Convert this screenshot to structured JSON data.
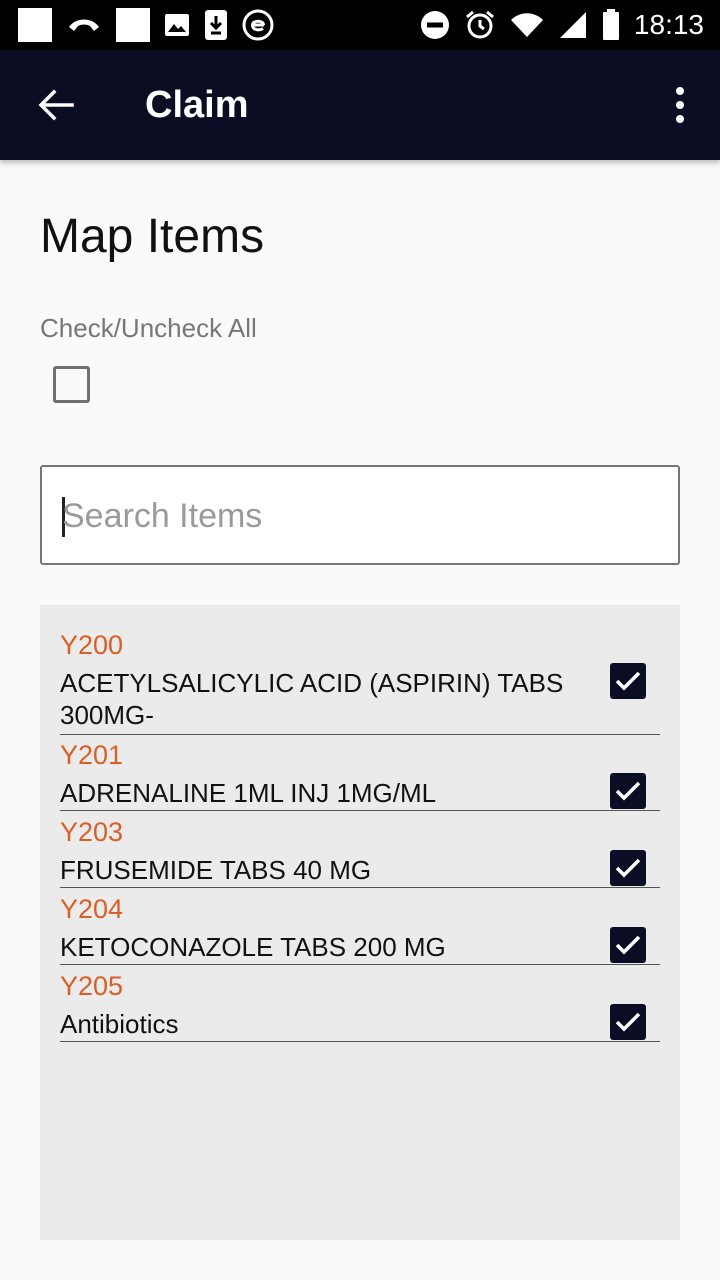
{
  "status_bar": {
    "left_icons": [
      "notification-square-icon",
      "missed-call-icon",
      "notification-square-icon",
      "image-icon",
      "download-icon",
      "e-badge-icon"
    ],
    "right_icons": [
      "do-not-disturb-icon",
      "alarm-icon",
      "wifi-icon",
      "signal-icon",
      "battery-icon"
    ],
    "time": "18:13"
  },
  "app_bar": {
    "title": "Claim",
    "background": "#0a0d24"
  },
  "page": {
    "title": "Map Items",
    "check_all_label": "Check/Uncheck All",
    "check_all_checked": false
  },
  "search": {
    "placeholder": "Search Items",
    "value": ""
  },
  "colors": {
    "item_code": "#d95f27",
    "checkbox_fill": "#0a0d24"
  },
  "items": [
    {
      "code": "Y200",
      "name": "ACETYLSALICYLIC ACID (ASPIRIN) TABS 300MG-",
      "checked": true
    },
    {
      "code": "Y201",
      "name": "ADRENALINE 1ML INJ 1MG/ML",
      "checked": true
    },
    {
      "code": "Y203",
      "name": "FRUSEMIDE TABS 40 MG",
      "checked": true
    },
    {
      "code": "Y204",
      "name": "KETOCONAZOLE TABS 200 MG",
      "checked": true
    },
    {
      "code": "Y205",
      "name": "Antibiotics",
      "checked": true
    }
  ]
}
